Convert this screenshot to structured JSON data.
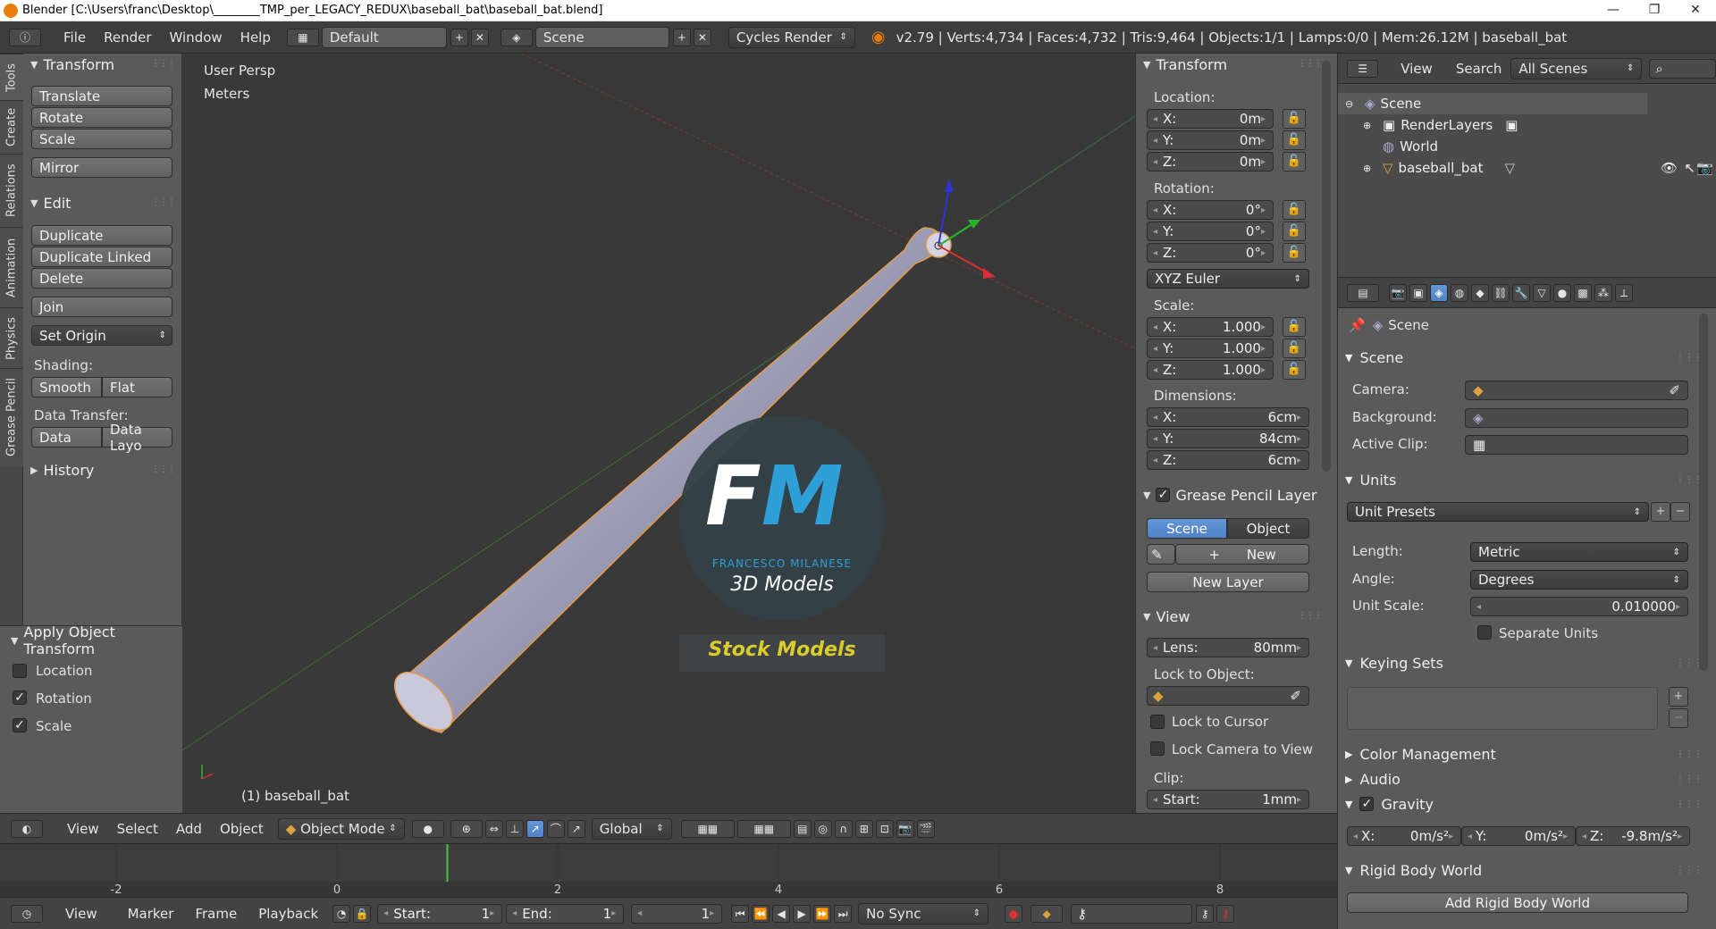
{
  "window": {
    "title": "Blender [C:\\Users\\franc\\Desktop\\________TMP_per_LEGACY_REDUX\\baseball_bat\\baseball_bat.blend]",
    "min": "—",
    "max": "❐",
    "close": "✕"
  },
  "infobar": {
    "menus": [
      "File",
      "Render",
      "Window",
      "Help"
    ],
    "screen_layout": "Default",
    "scene": "Scene",
    "render_engine": "Cycles Render",
    "stats": "v2.79 | Verts:4,734 | Faces:4,732 | Tris:9,464 | Objects:1/1 | Lamps:0/0 | Mem:26.12M | baseball_bat"
  },
  "tool_tabs": [
    "Tools",
    "Create",
    "Relations",
    "Animation",
    "Physics",
    "Grease Pencil"
  ],
  "toolshelf": {
    "transform_title": "Transform",
    "translate": "Translate",
    "rotate": "Rotate",
    "scale": "Scale",
    "mirror": "Mirror",
    "edit_title": "Edit",
    "duplicate": "Duplicate",
    "duplicate_linked": "Duplicate Linked",
    "delete": "Delete",
    "join": "Join",
    "set_origin": "Set Origin",
    "shading_label": "Shading:",
    "smooth": "Smooth",
    "flat": "Flat",
    "data_transfer_label": "Data Transfer:",
    "data": "Data",
    "data_layo": "Data Layo",
    "history_title": "History"
  },
  "operator_panel": {
    "title": "Apply Object Transform",
    "location": "Location",
    "rotation": "Rotation",
    "scale": "Scale",
    "location_checked": false,
    "rotation_checked": true,
    "scale_checked": true
  },
  "viewport": {
    "view_name": "User Persp",
    "units": "Meters",
    "object_label": "(1) baseball_bat",
    "watermark": {
      "initials_f": "F",
      "initials_m": "M",
      "name": "FRANCESCO MILANESE",
      "subtitle": "3D Models",
      "banner": "Stock Models"
    }
  },
  "viewport_header": {
    "menus": [
      "View",
      "Select",
      "Add",
      "Object"
    ],
    "mode": "Object Mode",
    "orientation": "Global"
  },
  "timeline": {
    "ticks": [
      "-2",
      "0",
      "2",
      "4",
      "6",
      "8"
    ],
    "current_frame": 1
  },
  "timeline_header": {
    "menus": [
      "View",
      "Marker",
      "Frame",
      "Playback"
    ],
    "start_label": "Start:",
    "start": "1",
    "end_label": "End:",
    "end": "1",
    "frame": "1",
    "sync": "No Sync"
  },
  "npanel": {
    "transform_title": "Transform",
    "location_label": "Location:",
    "loc": [
      {
        "axis": "X:",
        "value": "0m"
      },
      {
        "axis": "Y:",
        "value": "0m"
      },
      {
        "axis": "Z:",
        "value": "0m"
      }
    ],
    "rotation_label": "Rotation:",
    "rot": [
      {
        "axis": "X:",
        "value": "0°"
      },
      {
        "axis": "Y:",
        "value": "0°"
      },
      {
        "axis": "Z:",
        "value": "0°"
      }
    ],
    "rotation_mode": "XYZ Euler",
    "scale_label": "Scale:",
    "scl": [
      {
        "axis": "X:",
        "value": "1.000"
      },
      {
        "axis": "Y:",
        "value": "1.000"
      },
      {
        "axis": "Z:",
        "value": "1.000"
      }
    ],
    "dimensions_label": "Dimensions:",
    "dim": [
      {
        "axis": "X:",
        "value": "6cm"
      },
      {
        "axis": "Y:",
        "value": "84cm"
      },
      {
        "axis": "Z:",
        "value": "6cm"
      }
    ],
    "gp_title": "Grease Pencil Layer",
    "gp_scene": "Scene",
    "gp_object": "Object",
    "gp_new": "New",
    "gp_new_layer": "New Layer",
    "view_title": "View",
    "lens_label": "Lens:",
    "lens": "80mm",
    "lock_object_label": "Lock to Object:",
    "lock_cursor": "Lock to Cursor",
    "lock_camera": "Lock Camera to View",
    "clip_label": "Clip:",
    "clip_start_label": "Start:",
    "clip_start": "1mm"
  },
  "outliner": {
    "menus": [
      "View",
      "Search"
    ],
    "filter": "All Scenes",
    "rows": [
      {
        "label": "Scene"
      },
      {
        "label": "RenderLayers"
      },
      {
        "label": "World"
      },
      {
        "label": "baseball_bat"
      }
    ]
  },
  "properties": {
    "breadcrumb": "Scene",
    "scene_title": "Scene",
    "camera_label": "Camera:",
    "background_label": "Background:",
    "active_clip_label": "Active Clip:",
    "units_title": "Units",
    "unit_presets": "Unit Presets",
    "length_label": "Length:",
    "length": "Metric",
    "angle_label": "Angle:",
    "angle": "Degrees",
    "unit_scale_label": "Unit Scale:",
    "unit_scale": "0.010000",
    "separate_units": "Separate Units",
    "keying_title": "Keying Sets",
    "color_mgmt": "Color Management",
    "audio": "Audio",
    "gravity_title": "Gravity",
    "gx_label": "X:",
    "gx": "0m/s²",
    "gy_label": "Y:",
    "gy": "0m/s²",
    "gz_label": "Z:",
    "gz": "-9.8m/s²",
    "rigid_title": "Rigid Body World",
    "add_rigid": "Add Rigid Body World"
  }
}
